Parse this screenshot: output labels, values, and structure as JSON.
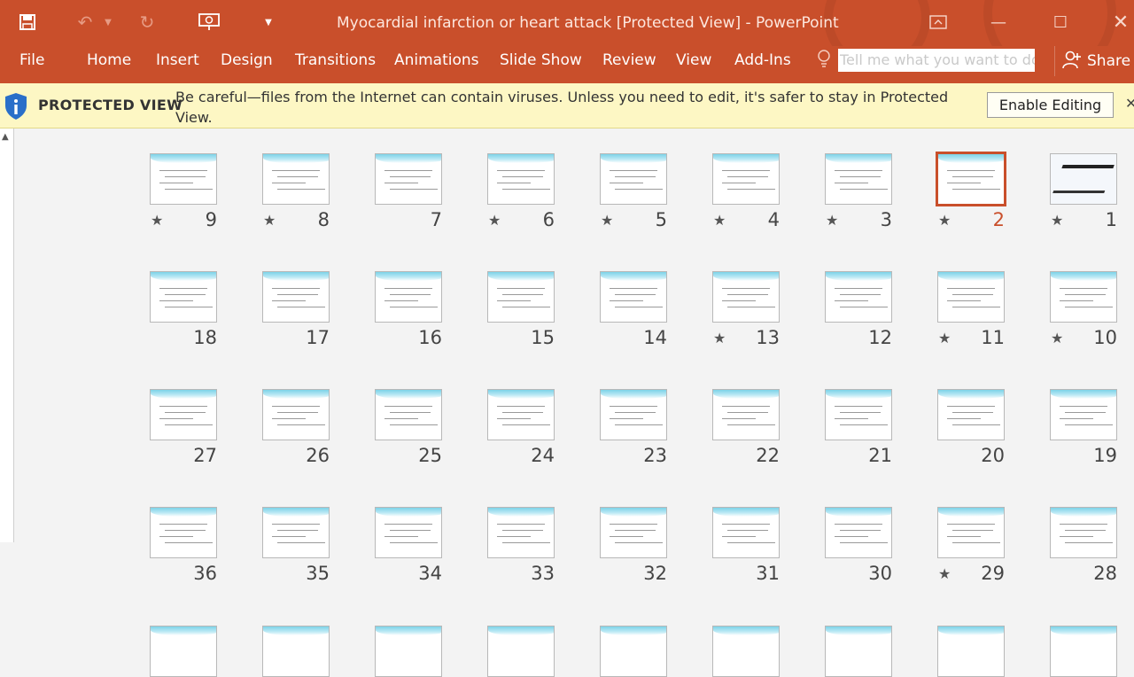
{
  "window": {
    "title": "Myocardial infarction or heart attack [Protected View] - PowerPoint"
  },
  "ribbon": {
    "tabs": [
      "File",
      "Home",
      "Insert",
      "Design",
      "Transitions",
      "Animations",
      "Slide Show",
      "Review",
      "View",
      "Add-Ins"
    ],
    "tell_me_placeholder": "Tell me what you want to do",
    "share_label": "Share"
  },
  "protected_view": {
    "label": "PROTECTED VIEW",
    "message": "Be careful—files from the Internet can contain viruses. Unless you need to edit, it's safer to stay in Protected View.",
    "enable_button": "Enable Editing"
  },
  "slides": [
    {
      "number": "9",
      "animated": true
    },
    {
      "number": "8",
      "animated": true
    },
    {
      "number": "7",
      "animated": false
    },
    {
      "number": "6",
      "animated": true
    },
    {
      "number": "5",
      "animated": true
    },
    {
      "number": "4",
      "animated": true
    },
    {
      "number": "3",
      "animated": true
    },
    {
      "number": "2",
      "animated": true,
      "selected": true
    },
    {
      "number": "1",
      "animated": true
    },
    {
      "number": "18",
      "animated": false
    },
    {
      "number": "17",
      "animated": false
    },
    {
      "number": "16",
      "animated": false
    },
    {
      "number": "15",
      "animated": false
    },
    {
      "number": "14",
      "animated": false
    },
    {
      "number": "13",
      "animated": true
    },
    {
      "number": "12",
      "animated": false
    },
    {
      "number": "11",
      "animated": true
    },
    {
      "number": "10",
      "animated": true
    },
    {
      "number": "27",
      "animated": false
    },
    {
      "number": "26",
      "animated": false
    },
    {
      "number": "25",
      "animated": false
    },
    {
      "number": "24",
      "animated": false
    },
    {
      "number": "23",
      "animated": false
    },
    {
      "number": "22",
      "animated": false
    },
    {
      "number": "21",
      "animated": false
    },
    {
      "number": "20",
      "animated": false
    },
    {
      "number": "19",
      "animated": false
    },
    {
      "number": "36",
      "animated": false
    },
    {
      "number": "35",
      "animated": false
    },
    {
      "number": "34",
      "animated": false
    },
    {
      "number": "33",
      "animated": false
    },
    {
      "number": "32",
      "animated": false
    },
    {
      "number": "31",
      "animated": false
    },
    {
      "number": "30",
      "animated": false
    },
    {
      "number": "29",
      "animated": true
    },
    {
      "number": "28",
      "animated": false
    }
  ],
  "colors": {
    "accent": "#c94f2b",
    "protected_bar": "#fdf7c4"
  }
}
